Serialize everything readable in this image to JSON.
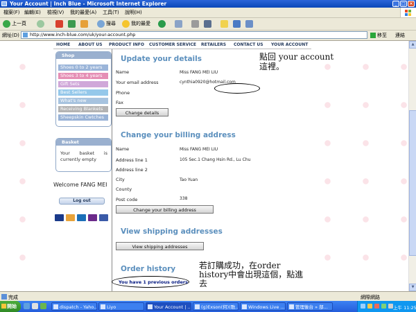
{
  "window": {
    "title": "Your Account | Inch Blue - Microsoft Internet Explorer",
    "menu": [
      "檔案(F)",
      "編輯(E)",
      "檢視(V)",
      "我的最愛(A)",
      "工具(T)",
      "說明(H)"
    ]
  },
  "toolbar": {
    "back": "上一頁",
    "search": "搜尋",
    "favorites": "我的最愛"
  },
  "address": {
    "label": "網址(D)",
    "url": "http://www.inch-blue.com/uk/your-account.php",
    "go": "移至",
    "links": "連結"
  },
  "site_nav": [
    "HOME",
    "ABOUT US",
    "PRODUCT INFO",
    "CUSTOMER SERVICE",
    "RETAILERS",
    "CONTACT US",
    "YOUR ACCOUNT"
  ],
  "shop": {
    "title": "Shop",
    "items": [
      {
        "label": "Shoes 0 to 2 years",
        "color": "#9bb5d9"
      },
      {
        "label": "Shoes 3 to 4 years",
        "color": "#e58fb5"
      },
      {
        "label": "Gift Sets",
        "color": "#d0a8d9"
      },
      {
        "label": "Best Sellers",
        "color": "#95c8ea"
      },
      {
        "label": "What's new",
        "color": "#a7c3df"
      },
      {
        "label": "Receiving Blankets",
        "color": "#b3b3b3"
      },
      {
        "label": "Sheepskin Cwtches",
        "color": "#98b2d6"
      }
    ]
  },
  "basket": {
    "title": "Basket",
    "text": "Your basket is currently empty"
  },
  "welcome": "Welcome FANG MEI",
  "logout": "Log out",
  "account": {
    "update_title": "Update your details",
    "name_label": "Name",
    "name_value": "Miss FANG MEI LIU",
    "email_label": "Your email address",
    "email_value": "cynthia0920@hotmail.com",
    "phone_label": "Phone",
    "fax_label": "Fax",
    "change_details": "Change details",
    "billing_title": "Change your billing address",
    "bill_name_label": "Name",
    "bill_name_value": "Miss FANG MEI LIU",
    "addr1_label": "Address line 1",
    "addr1_value": "105 Sec.1 Chang Hsin Rd., Lu Chu",
    "addr2_label": "Address line 2",
    "city_label": "City",
    "city_value": "Tao Yuan",
    "county_label": "County",
    "postcode_label": "Post code",
    "postcode_value": "338",
    "change_billing": "Change your billing address",
    "shipping_title": "View shipping addresses",
    "view_shipping": "View shipping addresses",
    "order_title": "Order history",
    "previous_orders": "You have 1 previous orders"
  },
  "annotations": {
    "note1_line1": "點回 your account",
    "note1_line2": "這裡。",
    "note2": "若訂購成功，在order history中會出現這個，點進去"
  },
  "status": {
    "text": "完成",
    "zone": "網際網路"
  },
  "taskbar": {
    "start": "開始",
    "tasks": [
      "dispatch - Yaho...",
      "Liyo",
      "Your Account | ...",
      "(g)Exson(何)(歌...",
      "Windows Live ...",
      "管理後台 » 部..."
    ],
    "clock": "上午 11:25"
  },
  "colors": {
    "heading": "#5b8fbd",
    "nav_text": "#243a5c",
    "title_bar": "#0a47b8"
  }
}
